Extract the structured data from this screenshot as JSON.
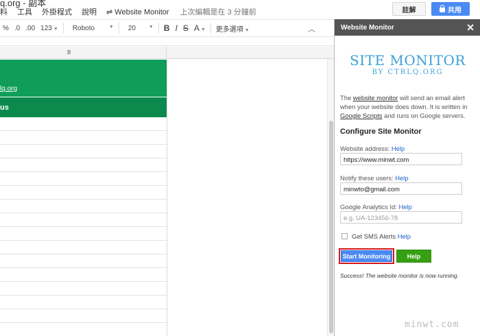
{
  "topbar": {
    "title_fragment": "q.org - 副本",
    "menu": [
      "料",
      "工具",
      "外掛程式",
      "說明"
    ],
    "addon": "Website Monitor",
    "addon_icon": "refresh-arrows-icon",
    "last_edit": "上次編輯是在 3 分鐘前",
    "comment_label": "註解",
    "share_label": "共用"
  },
  "toolbar": {
    "percent": "%",
    "dec_less": ".0",
    "dec_more": ".00",
    "number_format": "123",
    "font": "Roboto",
    "size": "20",
    "bold": "B",
    "italic": "I",
    "strike": "S",
    "text_color": "A",
    "more": "更多選項"
  },
  "sheet": {
    "column_header": "B",
    "link_text": "lq.org",
    "status_text": "us"
  },
  "panel": {
    "title": "Website Monitor",
    "logo_line1": "SITE MONITOR",
    "logo_line2": "BY CTRLQ.ORG",
    "desc_pre": "The ",
    "desc_link1": "website monitor",
    "desc_mid": " will send an email alert when your website does down. It is written in ",
    "desc_link2": "Google Scripts",
    "desc_post": " and runs on Google servers.",
    "heading": "Configure Site Monitor",
    "website_label": "Website address:",
    "website_value": "https://www.minwt.com",
    "notify_label": "Notify these users:",
    "notify_value": "minwto@gmail.com",
    "ga_label": "Google Analytics Id:",
    "ga_placeholder": "e.g. UA-123456-78",
    "help": "Help",
    "sms_label": "Get SMS Alerts",
    "start_button": "Start Monitoring",
    "help_button": "Help",
    "success": "Success! The website monitor is now running."
  },
  "watermark": "minwt.com",
  "colors": {
    "green_header": "#109d59",
    "green_row": "#0c8a4d",
    "share_blue": "#4a8af4",
    "panel_header": "#545454",
    "logo_blue": "#3da0d6",
    "help_green": "#379f13",
    "highlight_red": "#d6161a"
  }
}
